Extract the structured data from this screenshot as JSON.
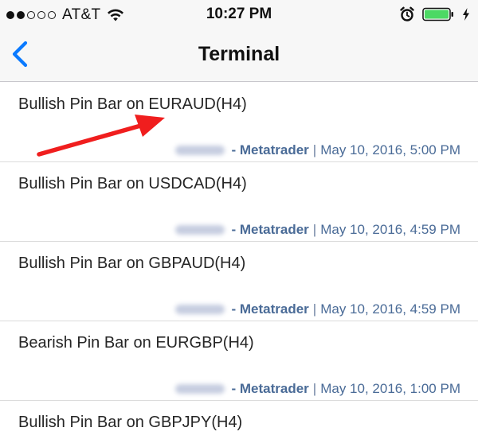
{
  "status_bar": {
    "carrier": "AT&T",
    "time": "10:27 PM",
    "signal_filled": 2,
    "signal_total": 5
  },
  "nav": {
    "title": "Terminal",
    "back_icon": "chevron-left-icon"
  },
  "messages": [
    {
      "title": "Bullish Pin Bar on EURAUD(H4)",
      "sender": "- Metatrader",
      "timestamp": "May 10, 2016, 5:00 PM"
    },
    {
      "title": "Bullish Pin Bar on USDCAD(H4)",
      "sender": "- Metatrader",
      "timestamp": "May 10, 2016, 4:59 PM"
    },
    {
      "title": "Bullish Pin Bar on GBPAUD(H4)",
      "sender": "- Metatrader",
      "timestamp": "May 10, 2016, 4:59 PM"
    },
    {
      "title": "Bearish Pin Bar on EURGBP(H4)",
      "sender": "- Metatrader",
      "timestamp": "May 10, 2016, 1:00 PM"
    },
    {
      "title": "Bullish Pin Bar on GBPJPY(H4)"
    }
  ],
  "meta_separator": "|",
  "colors": {
    "accent": "#0a7aff",
    "meta_text": "#4a6b97",
    "annotation_arrow": "#f01e1e",
    "battery": "#4cd964"
  }
}
